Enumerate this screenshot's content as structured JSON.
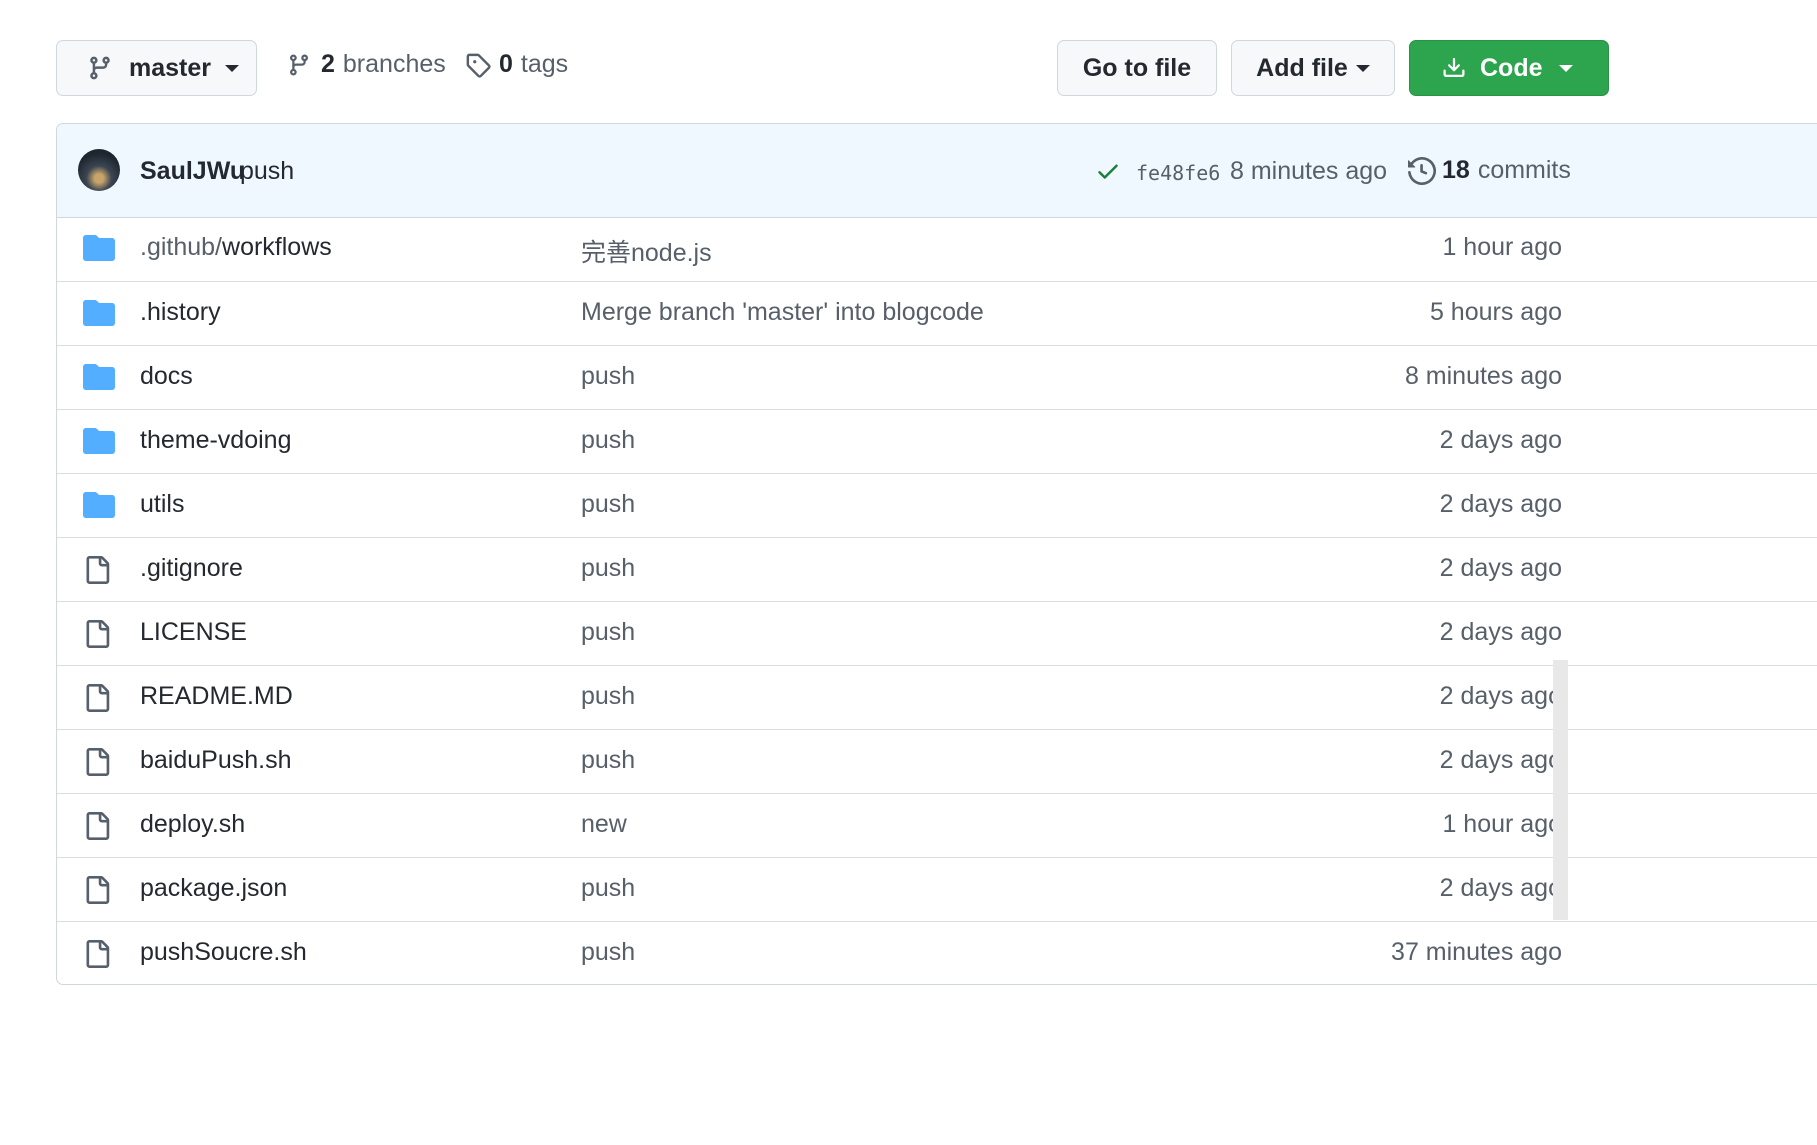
{
  "toolbar": {
    "branch_label": "master",
    "branches_count": "2",
    "branches_label": "branches",
    "tags_count": "0",
    "tags_label": "tags",
    "go_to_file_label": "Go to file",
    "add_file_label": "Add file",
    "code_label": "Code"
  },
  "commit": {
    "author": "SaulJWu",
    "message": "push",
    "sha": "fe48fe6",
    "time": "8 minutes ago",
    "commits_count": "18",
    "commits_label": "commits"
  },
  "files": [
    {
      "type": "folder",
      "name_prefix": ".github/",
      "name": "workflows",
      "message": "完善node.js",
      "age": "1 hour ago"
    },
    {
      "type": "folder",
      "name_prefix": "",
      "name": ".history",
      "message": "Merge branch 'master' into blogcode",
      "age": "5 hours ago"
    },
    {
      "type": "folder",
      "name_prefix": "",
      "name": "docs",
      "message": "push",
      "age": "8 minutes ago"
    },
    {
      "type": "folder",
      "name_prefix": "",
      "name": "theme-vdoing",
      "message": "push",
      "age": "2 days ago"
    },
    {
      "type": "folder",
      "name_prefix": "",
      "name": "utils",
      "message": "push",
      "age": "2 days ago"
    },
    {
      "type": "file",
      "name_prefix": "",
      "name": ".gitignore",
      "message": "push",
      "age": "2 days ago"
    },
    {
      "type": "file",
      "name_prefix": "",
      "name": "LICENSE",
      "message": "push",
      "age": "2 days ago"
    },
    {
      "type": "file",
      "name_prefix": "",
      "name": "README.MD",
      "message": "push",
      "age": "2 days ago"
    },
    {
      "type": "file",
      "name_prefix": "",
      "name": "baiduPush.sh",
      "message": "push",
      "age": "2 days ago"
    },
    {
      "type": "file",
      "name_prefix": "",
      "name": "deploy.sh",
      "message": "new",
      "age": "1 hour ago"
    },
    {
      "type": "file",
      "name_prefix": "",
      "name": "package.json",
      "message": "push",
      "age": "2 days ago"
    },
    {
      "type": "file",
      "name_prefix": "",
      "name": "pushSoucre.sh",
      "message": "push",
      "age": "37 minutes ago"
    }
  ],
  "colors": {
    "folder": "#54aeff",
    "file": "#57606a",
    "code_button": "#2da44e",
    "check": "#1a7f37",
    "commit_bar": "#f0f8ff"
  }
}
